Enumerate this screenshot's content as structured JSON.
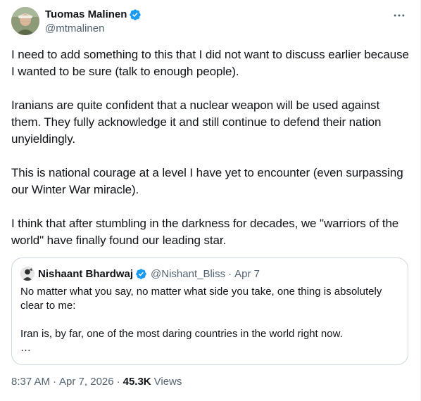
{
  "author": {
    "display_name": "Tuomas Malinen",
    "handle": "@mtmalinen",
    "verified_icon": "verified-badge-icon",
    "avatar_icon": "profile-photo"
  },
  "more_icon": "more-options-icon",
  "body": {
    "paragraphs": [
      "I need to add something to this that I did not want to discuss earlier because I wanted to be sure (talk to enough people).",
      "Iranians are quite confident that a nuclear weapon will be used against them. They fully acknowledge it and still continue to defend their nation unyieldingly.",
      "This is national courage at a level I have yet to encounter (even surpassing our Winter War miracle).",
      "I think that after stumbling in the darkness for decades, we \"warriors of the world\" have finally found our leading star."
    ]
  },
  "quoted_tweet": {
    "display_name": "Nishaant Bhardwaj",
    "handle": "@Nishant_Bliss",
    "separator": "·",
    "date": "Apr 7",
    "paragraphs": [
      "No matter what you say, no matter what side you take, one thing is absolutely clear to me:",
      "Iran is, by far, one of the most daring countries in the world right now."
    ],
    "ellipsis": "…"
  },
  "meta": {
    "time": "8:37 AM",
    "separator": "·",
    "date": "Apr 7, 2026",
    "views_count": "45.3K",
    "views_label": "Views"
  },
  "colors": {
    "verified_blue": "#1d9bf0",
    "text_primary": "#0f1419",
    "text_secondary": "#536471",
    "border": "#cfd9de"
  }
}
